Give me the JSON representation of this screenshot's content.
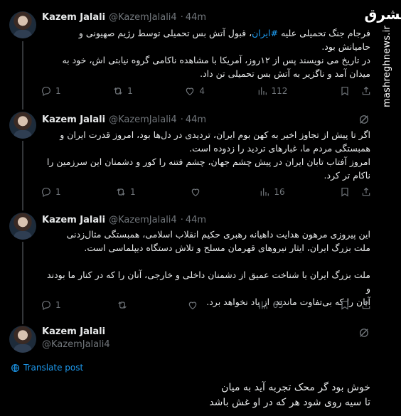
{
  "watermark": {
    "logo": "مشرق",
    "site": "mashreghnews.ir"
  },
  "author": {
    "name": "Kazem Jalali",
    "handle": "@KazemJalali4",
    "time": "44m"
  },
  "tweets": [
    {
      "lines": [
        [
          "فرجام جنگ تحمیلی علیه ",
          "#ایران",
          "، قبول آتش بس تحمیلی توسط رژیم صهیونی و"
        ],
        "حامیانش بود.",
        "در تاریخ می نویسند پس از ۱۲روز، آمریکا با مشاهده ناکامی گروه نیابتی اش، خود به",
        "میدان آمد و ناگزیر به آتش بس تحمیلی تن داد."
      ],
      "replies": "1",
      "reposts": "1",
      "likes": "4",
      "views": "112"
    },
    {
      "lines": [
        "اگر تا پیش از تجاوز  اخیر به کهن بوم ایران، تردیدی در دل‌ها بود، امروز قدرت ایران و",
        "همبستگی مردم ما، غبارهای تردید را زدوده است.",
        "امروز آفتاب تابان ایران در پیش چشم جهان، چشم فتنه را کور و دشمنان این سرزمین  را",
        "ناکام تر کرد."
      ],
      "replies": "1",
      "reposts": "1",
      "likes": "",
      "views": "16"
    },
    {
      "lines": [
        "این پیروزی مرهون هدایت داهیانه رهبری حکیم انقلاب اسلامی، همبستگی مثال‌زدنی",
        "ملت بزرگ ایران، ایثار نیروهای قهرمان مسلح و تلاش دستگاه دیپلماسی است.",
        "",
        "ملت بزرگ ایران با شناخت عمیق از دشمنان داخلی و خارجی، آنان را که در کنار ما بودند و",
        "آنان را که بی‌تفاوت ماندند، از یاد نخواهد برد."
      ],
      "replies": "1",
      "reposts": "",
      "likes": "",
      "views": "65"
    }
  ],
  "last_tweet": {
    "translate": "Translate post",
    "lines": [
      "خوش بود گر محک تجربه آید به میان",
      "تا سیه روی شود هر که در او غش باشد"
    ]
  },
  "colors": {
    "link": "#1d9bf0",
    "muted": "#71767b",
    "background": "#000000"
  }
}
